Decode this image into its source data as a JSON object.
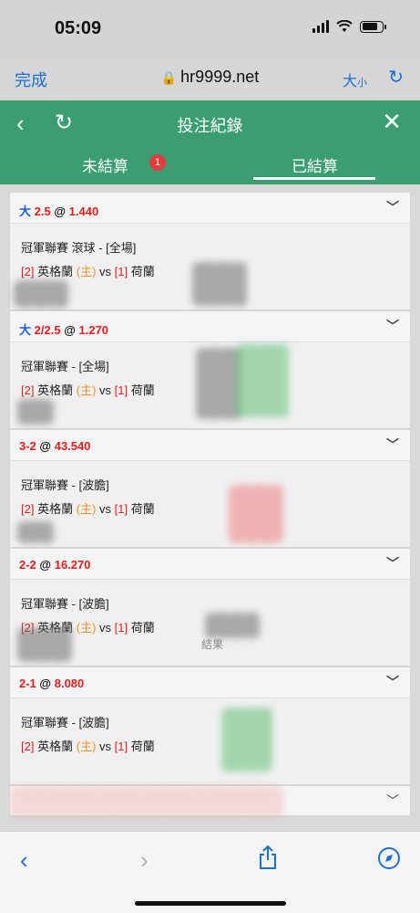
{
  "status": {
    "time": "05:09"
  },
  "browser": {
    "done_label": "完成",
    "host": "hr9999.net",
    "text_size_big": "大",
    "text_size_small": "小"
  },
  "header": {
    "title": "投注紀錄"
  },
  "tabs": {
    "unsettled_label": "未結算",
    "unsettled_count": "1",
    "settled_label": "已結算"
  },
  "bets": [
    {
      "side": "大",
      "line": "2.5",
      "odds": "1.440",
      "league": "冠軍聯賽 滾球 - [全場]",
      "team1_rank": "[2]",
      "team1": "英格蘭",
      "home_tag": "(主)",
      "vs": "vs",
      "team2_rank": "[1]",
      "team2": "荷蘭",
      "result": ""
    },
    {
      "side": "大",
      "line": "2/2.5",
      "odds": "1.270",
      "league": "冠軍聯賽 - [全場]",
      "team1_rank": "[2]",
      "team1": "英格蘭",
      "home_tag": "(主)",
      "vs": "vs",
      "team2_rank": "[1]",
      "team2": "荷蘭",
      "result": ""
    },
    {
      "side": "",
      "line": "3-2",
      "odds": "43.540",
      "league": "冠軍聯賽 - [波膽]",
      "team1_rank": "[2]",
      "team1": "英格蘭",
      "home_tag": "(主)",
      "vs": "vs",
      "team2_rank": "[1]",
      "team2": "荷蘭",
      "result": ""
    },
    {
      "side": "",
      "line": "2-2",
      "odds": "16.270",
      "league": "冠軍聯賽 - [波膽]",
      "team1_rank": "[2]",
      "team1": "英格蘭",
      "home_tag": "(主)",
      "vs": "vs",
      "team2_rank": "[1]",
      "team2": "荷蘭",
      "result": "結果"
    },
    {
      "side": "",
      "line": "2-1",
      "odds": "8.080",
      "league": "冠軍聯賽 - [波膽]",
      "team1_rank": "[2]",
      "team1": "英格蘭",
      "home_tag": "(主)",
      "vs": "vs",
      "team2_rank": "[1]",
      "team2": "荷蘭",
      "result": ""
    }
  ],
  "at_symbol": "@",
  "colors": {
    "header_green": "#3a9e72",
    "accent_blue": "#1b6fd6",
    "odds_red": "#e41e1e",
    "home_orange": "#f0922b"
  },
  "icons": {
    "back": "chevron-left-icon",
    "refresh": "refresh-icon",
    "close": "close-icon",
    "lock": "lock-icon",
    "share": "share-icon",
    "compass": "compass-icon"
  }
}
